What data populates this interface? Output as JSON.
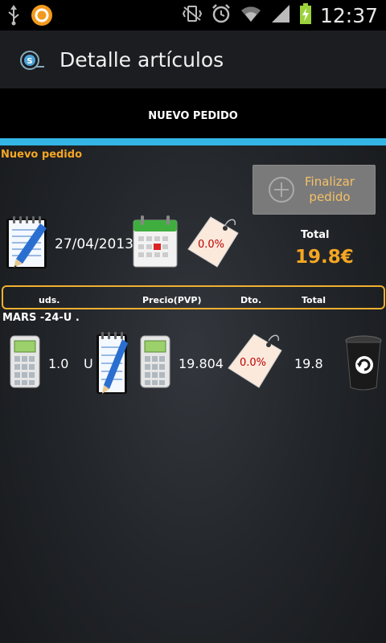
{
  "status_bar": {
    "time": "12:37",
    "icons": [
      "usb-icon",
      "app-notification-icon",
      "vibrate-icon",
      "alarm-icon",
      "wifi-icon",
      "signal-icon",
      "battery-charging-icon"
    ]
  },
  "action_bar": {
    "title": "Detalle artículos",
    "logo_icon": "app-logo-icon"
  },
  "tabs": [
    {
      "label": "NUEVO PEDIDO",
      "selected": true
    }
  ],
  "colors": {
    "accent": "#33b5e5",
    "highlight": "#f5a623"
  },
  "order": {
    "section_title": "Nuevo pedido",
    "finalize_button": {
      "line1": "Finalizar",
      "line2": "pedido"
    },
    "date": "27/04/2013",
    "discount": "0.0%",
    "total_label": "Total",
    "total_value": "19.8€"
  },
  "table": {
    "headers": [
      "uds.",
      "Precio(PVP)",
      "Dto.",
      "Total"
    ],
    "rows": [
      {
        "name": "MARS -24-U .",
        "units": "1.0",
        "unit_type": "U",
        "price": "19.804",
        "discount": "0.0%",
        "total": "19.8"
      }
    ]
  }
}
